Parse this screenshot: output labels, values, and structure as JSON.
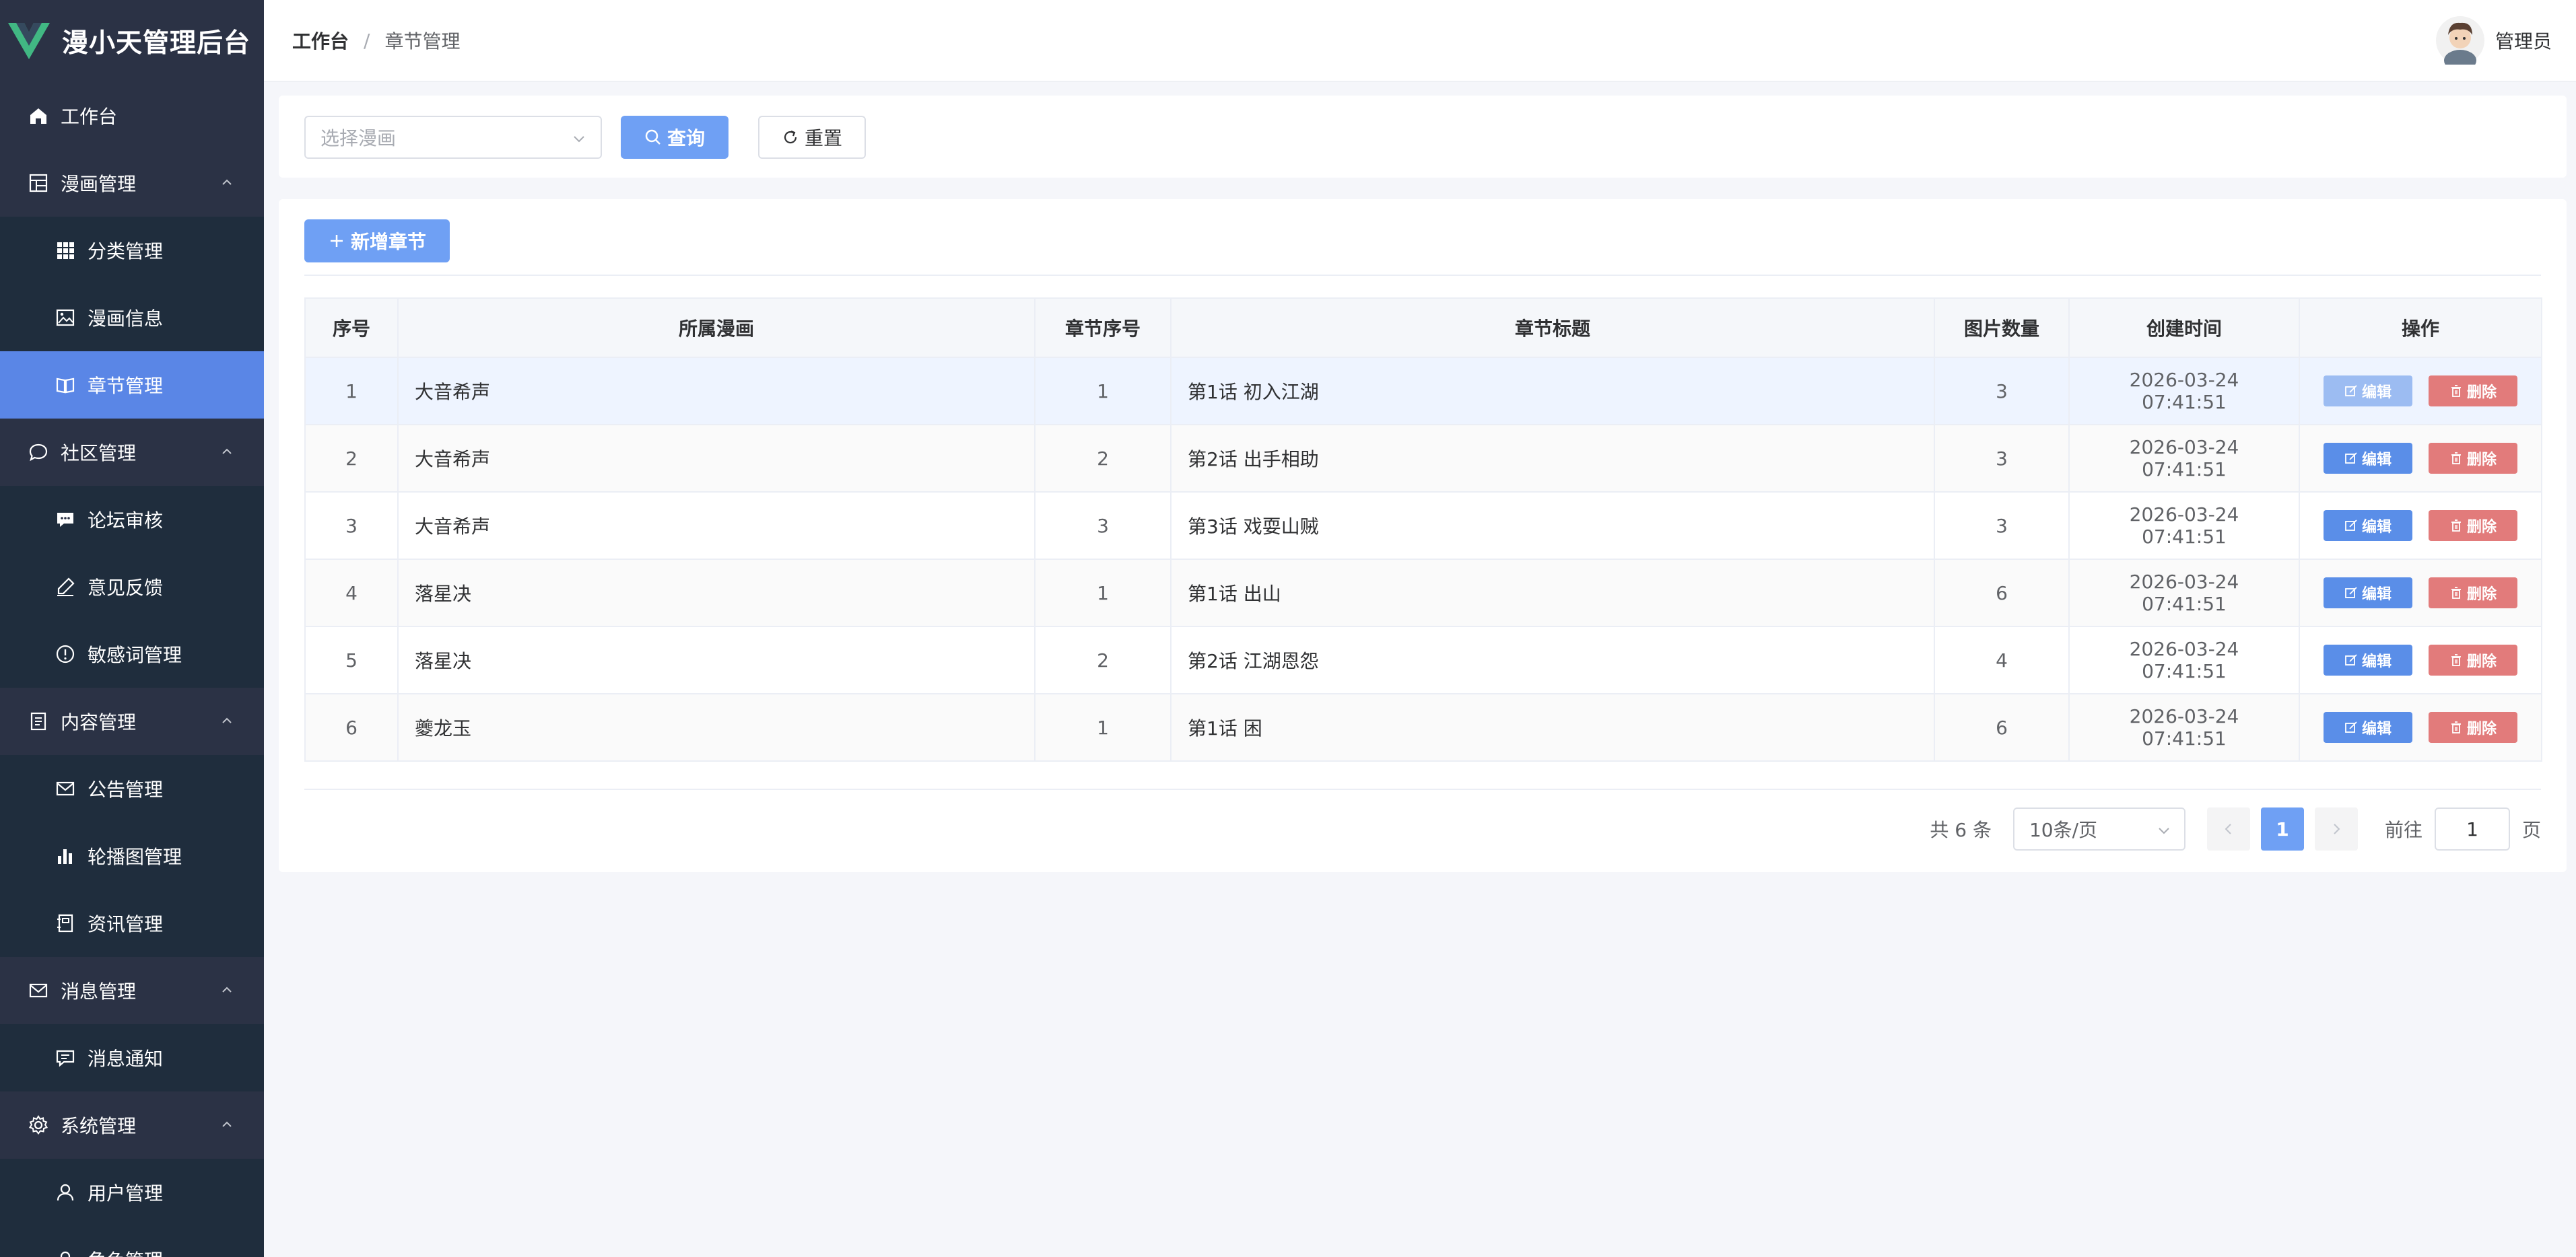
{
  "app": {
    "title": "漫小天管理后台"
  },
  "sidebar": {
    "items": [
      {
        "label": "工作台",
        "icon": "home-icon",
        "level": "top"
      },
      {
        "label": "漫画管理",
        "icon": "grid-icon",
        "level": "top",
        "expanded": true
      },
      {
        "label": "分类管理",
        "icon": "apps-icon",
        "level": "sub"
      },
      {
        "label": "漫画信息",
        "icon": "picture-icon",
        "level": "sub"
      },
      {
        "label": "章节管理",
        "icon": "book-icon",
        "level": "sub",
        "active": true
      },
      {
        "label": "社区管理",
        "icon": "chat-icon",
        "level": "top",
        "expanded": true
      },
      {
        "label": "论坛审核",
        "icon": "chat-dots-icon",
        "level": "sub"
      },
      {
        "label": "意见反馈",
        "icon": "edit-pen-icon",
        "level": "sub"
      },
      {
        "label": "敏感词管理",
        "icon": "warning-icon",
        "level": "sub"
      },
      {
        "label": "内容管理",
        "icon": "document-icon",
        "level": "top",
        "expanded": true
      },
      {
        "label": "公告管理",
        "icon": "mail-icon",
        "level": "sub"
      },
      {
        "label": "轮播图管理",
        "icon": "bar-chart-icon",
        "level": "sub"
      },
      {
        "label": "资讯管理",
        "icon": "notebook-icon",
        "level": "sub"
      },
      {
        "label": "消息管理",
        "icon": "message-icon",
        "level": "top",
        "expanded": true
      },
      {
        "label": "消息通知",
        "icon": "chat-square-icon",
        "level": "sub"
      },
      {
        "label": "系统管理",
        "icon": "gear-icon",
        "level": "top",
        "expanded": true
      },
      {
        "label": "用户管理",
        "icon": "user-icon",
        "level": "sub"
      },
      {
        "label": "角色管理",
        "icon": "role-icon",
        "level": "sub"
      }
    ]
  },
  "header": {
    "breadcrumb_home": "工作台",
    "breadcrumb_sep": "/",
    "breadcrumb_current": "章节管理",
    "user_name": "管理员"
  },
  "search": {
    "select_placeholder": "选择漫画",
    "query_label": "查询",
    "reset_label": "重置"
  },
  "toolbar": {
    "add_label": "新增章节"
  },
  "table": {
    "columns": [
      "序号",
      "所属漫画",
      "章节序号",
      "章节标题",
      "图片数量",
      "创建时间",
      "操作"
    ],
    "rows": [
      {
        "index": "1",
        "comic": "大音希声",
        "chapter_no": "1",
        "title": "第1话 初入江湖",
        "images": "3",
        "created": "2026-03-24 07:41:51"
      },
      {
        "index": "2",
        "comic": "大音希声",
        "chapter_no": "2",
        "title": "第2话 出手相助",
        "images": "3",
        "created": "2026-03-24 07:41:51"
      },
      {
        "index": "3",
        "comic": "大音希声",
        "chapter_no": "3",
        "title": "第3话 戏耍山贼",
        "images": "3",
        "created": "2026-03-24 07:41:51"
      },
      {
        "index": "4",
        "comic": "落星决",
        "chapter_no": "1",
        "title": "第1话 出山",
        "images": "6",
        "created": "2026-03-24 07:41:51"
      },
      {
        "index": "5",
        "comic": "落星决",
        "chapter_no": "2",
        "title": "第2话 江湖恩怨",
        "images": "4",
        "created": "2026-03-24 07:41:51"
      },
      {
        "index": "6",
        "comic": "夔龙玉",
        "chapter_no": "1",
        "title": "第1话 困",
        "images": "6",
        "created": "2026-03-24 07:41:51"
      }
    ],
    "edit_label": "编辑",
    "delete_label": "删除"
  },
  "pagination": {
    "total_text": "共 6 条",
    "page_size": "10条/页",
    "current_page": "1",
    "goto_prefix": "前往",
    "goto_value": "1",
    "goto_suffix": "页"
  },
  "colors": {
    "sidebar_bg": "#2b3245",
    "submenu_bg": "#1f2d3d",
    "active": "#5a86e6",
    "primary": "#6fa0f4",
    "danger": "#e27b7b",
    "brand_green": "#41b883"
  }
}
